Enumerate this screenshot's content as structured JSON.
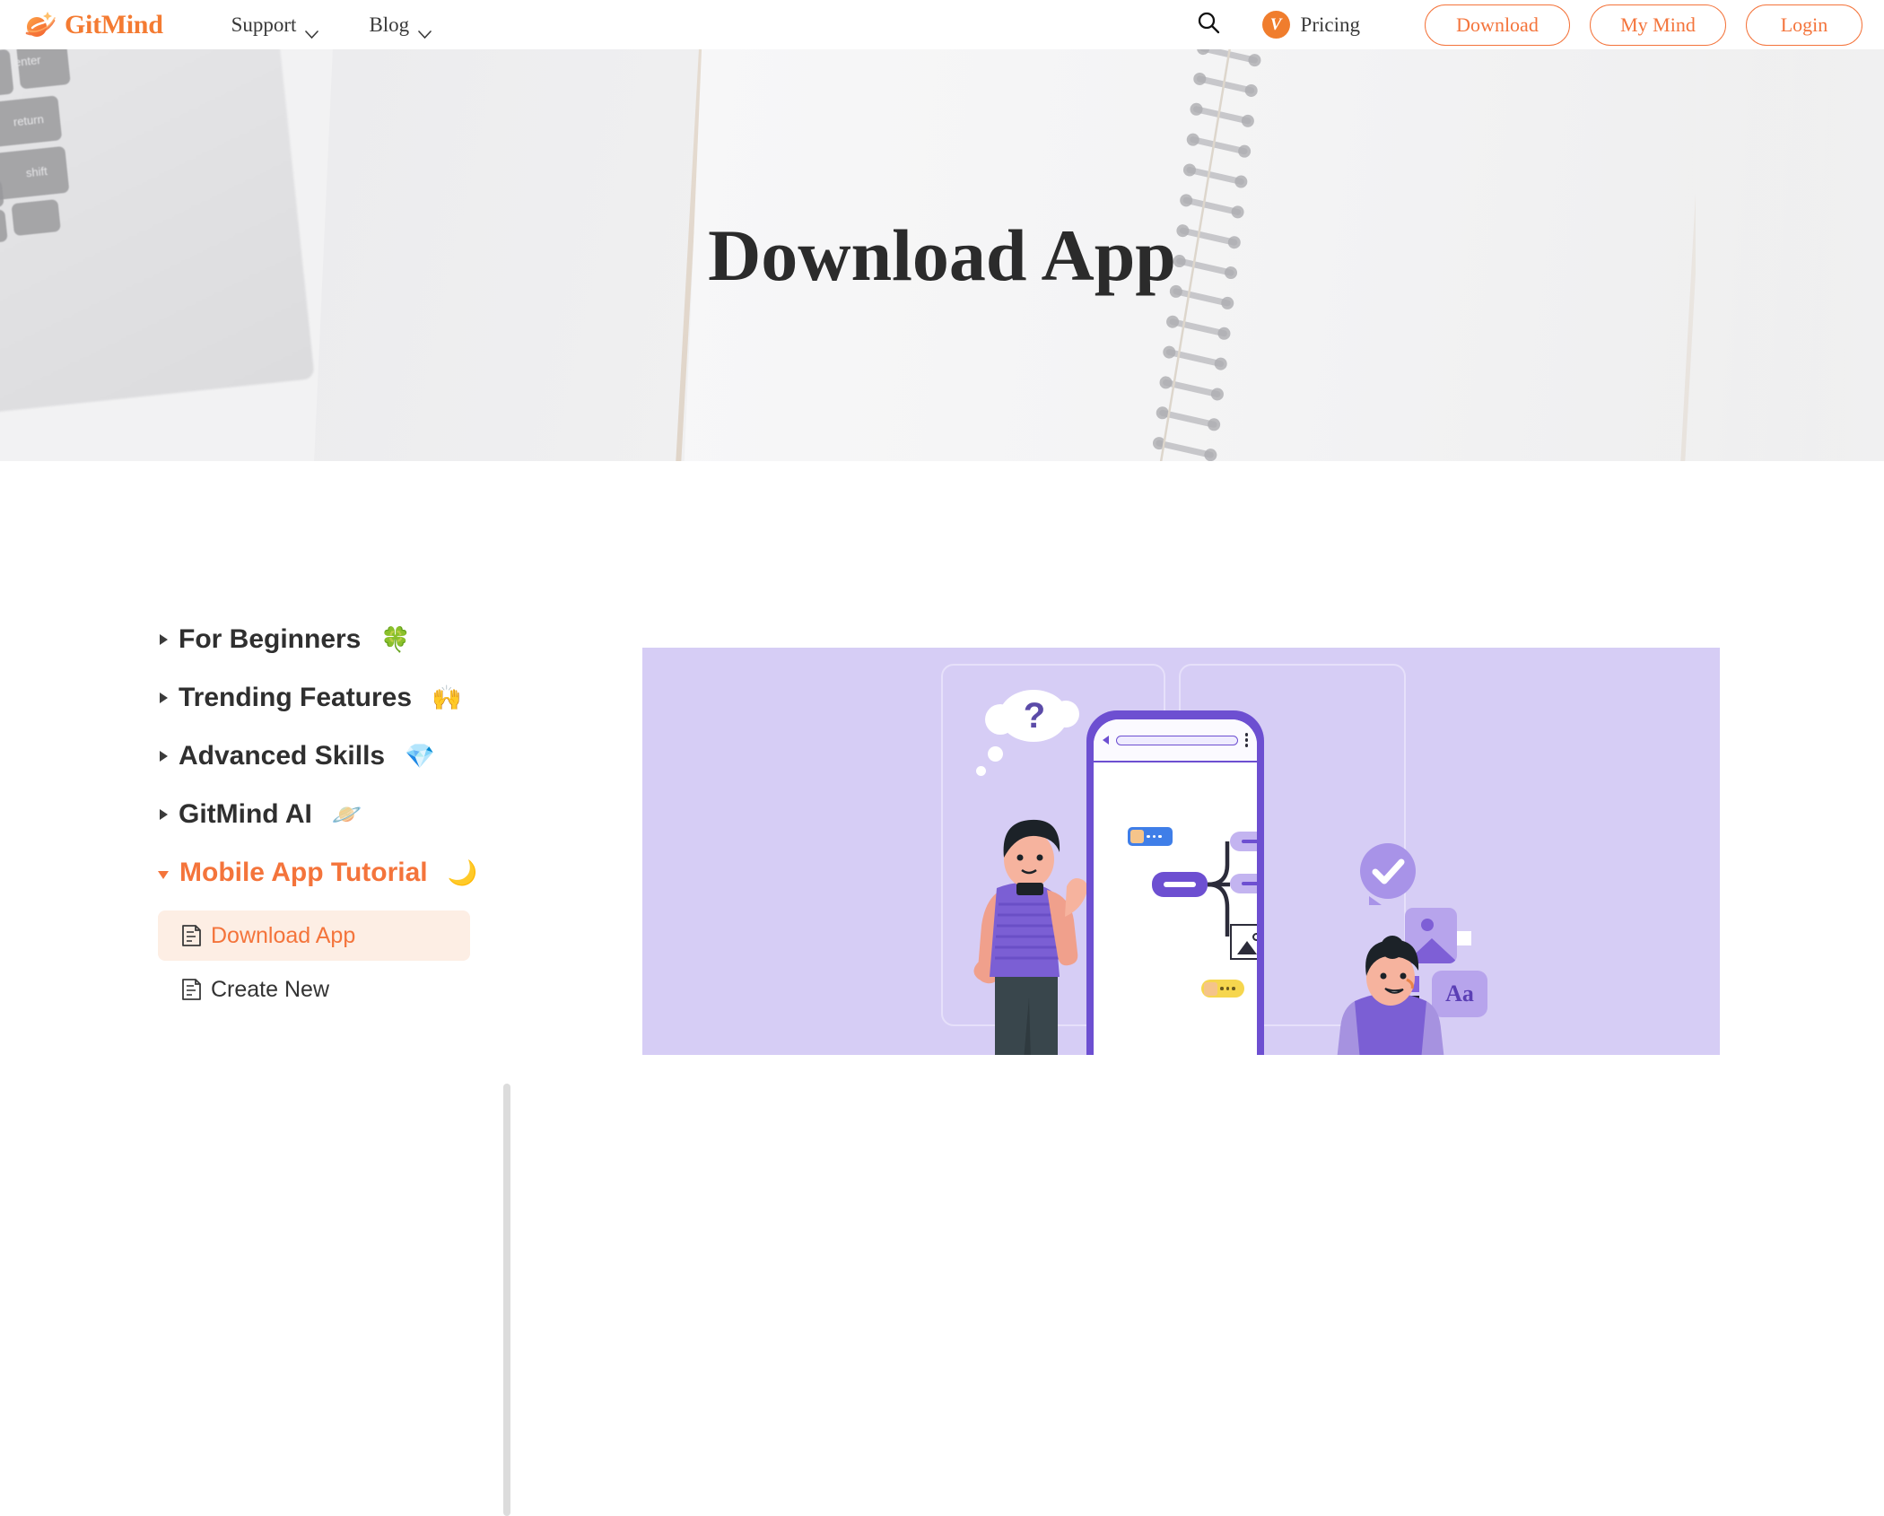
{
  "navbar": {
    "logo_text": "GitMind",
    "logo_icon": "gitmind-planet-logo",
    "links": [
      {
        "label": "Support",
        "icon": "chevron-down-icon"
      },
      {
        "label": "Blog",
        "icon": "chevron-down-icon"
      }
    ],
    "search_icon": "search-icon",
    "pricing": {
      "label": "Pricing",
      "badge_letter": "V",
      "badge_color": "#F07D2D"
    },
    "buttons": [
      {
        "label": "Download",
        "name": "download-button"
      },
      {
        "label": "My Mind",
        "name": "my-mind-button"
      },
      {
        "label": "Login",
        "name": "login-button"
      }
    ]
  },
  "hero": {
    "title": "Download App",
    "background": "notebook-and-keyboard-photo"
  },
  "sidebar": {
    "items": [
      {
        "label": "For Beginners",
        "emoji": "🍀",
        "expanded": false,
        "active": false
      },
      {
        "label": "Trending Features",
        "emoji": "🙌",
        "expanded": false,
        "active": false
      },
      {
        "label": "Advanced Skills",
        "emoji": "💎",
        "expanded": false,
        "active": false
      },
      {
        "label": "GitMind AI",
        "emoji": "🪐",
        "expanded": false,
        "active": false
      },
      {
        "label": "Mobile App Tutorial",
        "emoji": "🌙",
        "expanded": true,
        "active": true
      }
    ],
    "subitems": [
      {
        "label": "Download App",
        "icon": "document-icon",
        "active": true
      },
      {
        "label": "Create New",
        "icon": "document-icon",
        "active": false
      }
    ]
  },
  "illustration": {
    "name": "mobile-app-mindmap-illustration",
    "background_color": "#d6cdf5",
    "accent_color": "#6d4fd1",
    "thought_mark": "?",
    "text_card_label": "Aa"
  },
  "colors": {
    "brand_orange": "#F4743B",
    "active_bg": "#fdeee4",
    "purple": "#6d4fd1"
  }
}
